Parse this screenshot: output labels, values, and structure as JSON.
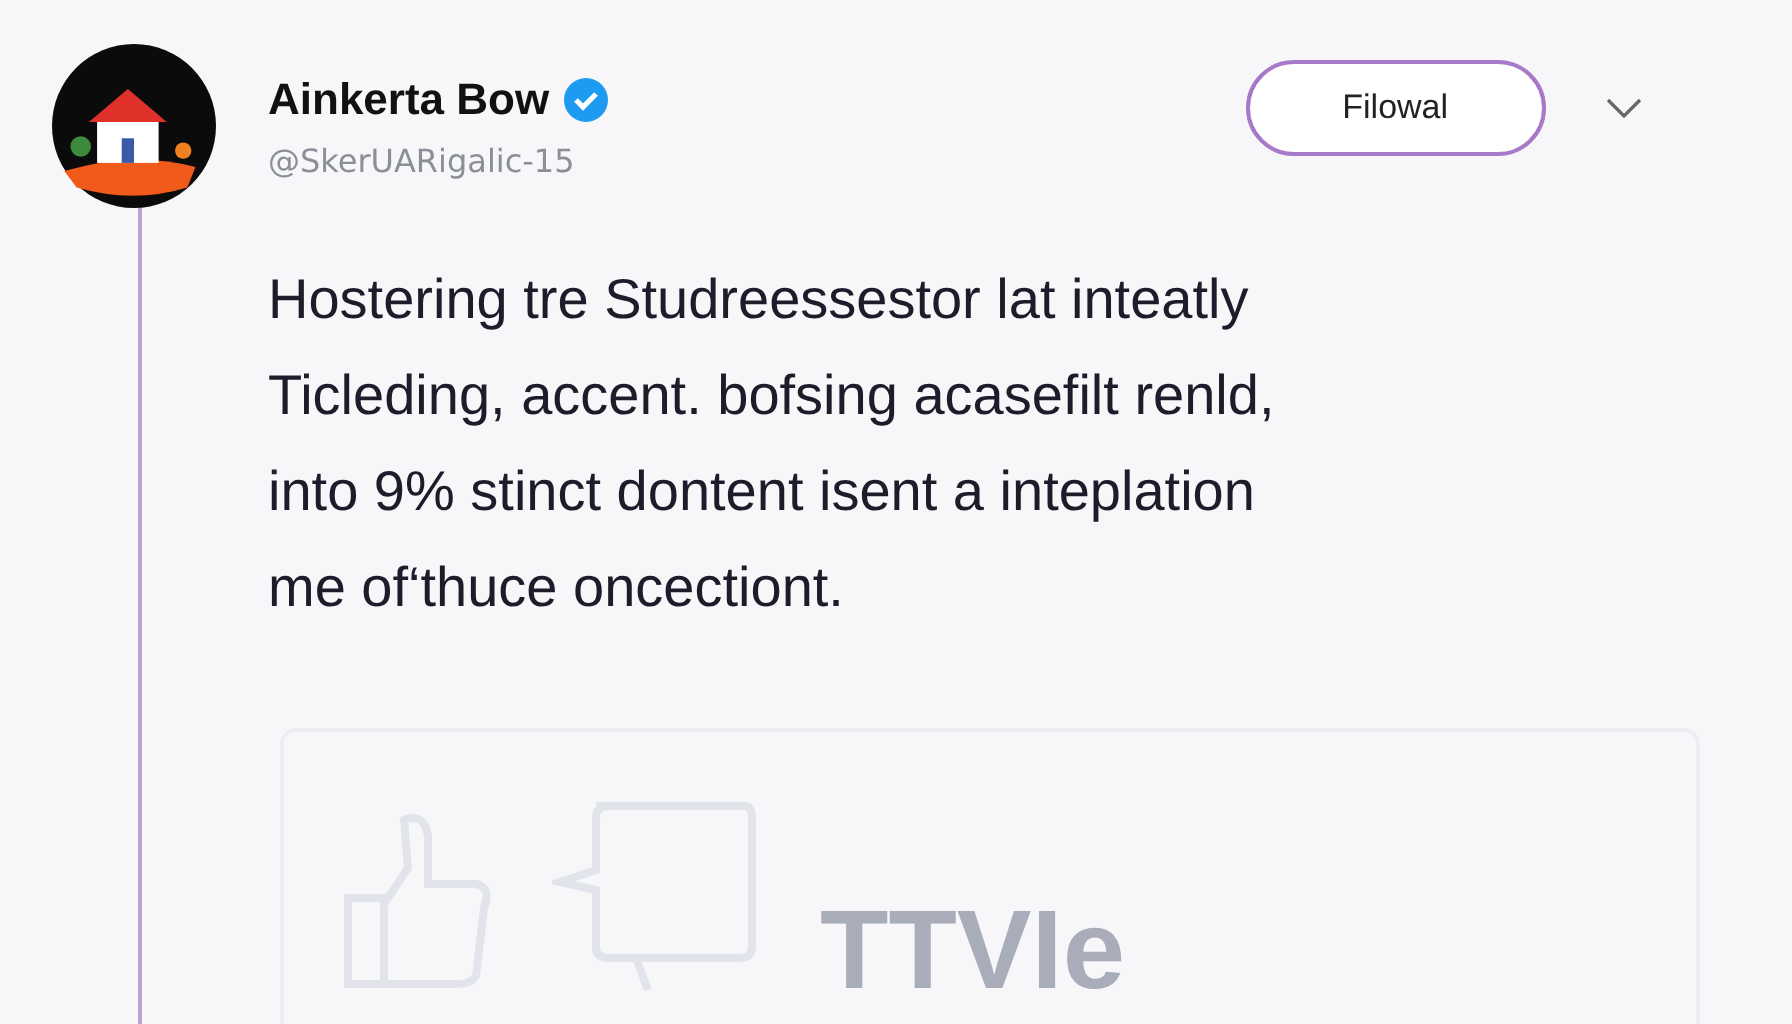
{
  "author": {
    "name": "Ainkerta Bow",
    "verified": true,
    "handle": "@SkerUARigalic-15"
  },
  "follow_button": {
    "label": "Filowal"
  },
  "body": [
    "Hostering tre Studreessestor lat inteatly",
    "Ticleding, accent. bofsing acasefilt renld,",
    "into 9% stinct dontent isent a inteplation",
    "me of‘thuce oncectiont."
  ],
  "card": {
    "text": "TTVIe"
  }
}
